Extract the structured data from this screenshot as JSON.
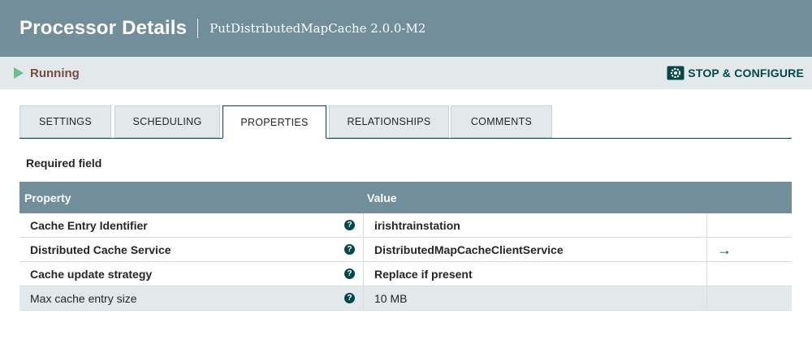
{
  "header": {
    "title": "Processor Details",
    "subtitle": "PutDistributedMapCache 2.0.0-M2"
  },
  "status": {
    "text": "Running",
    "icon": "play-icon"
  },
  "actions": {
    "stop_configure": "STOP & CONFIGURE",
    "icon": "gear-icon"
  },
  "tabs": [
    {
      "label": "SETTINGS"
    },
    {
      "label": "SCHEDULING"
    },
    {
      "label": "PROPERTIES",
      "active": true
    },
    {
      "label": "RELATIONSHIPS"
    },
    {
      "label": "COMMENTS"
    }
  ],
  "properties": {
    "required_label": "Required field",
    "columns": {
      "property": "Property",
      "value": "Value"
    },
    "rows": [
      {
        "name": "Cache Entry Identifier",
        "value": "irishtrainstation",
        "required": true
      },
      {
        "name": "Distributed Cache Service",
        "value": "DistributedMapCacheClientService",
        "required": true,
        "goto": "→"
      },
      {
        "name": "Cache update strategy",
        "value": "Replace if present",
        "required": true
      },
      {
        "name": "Max cache entry size",
        "value": "10 MB",
        "required": false
      }
    ],
    "help_icon": "?"
  },
  "colors": {
    "header": "#728e9b",
    "accent": "#004849",
    "running": "#6dbd8e",
    "status_text": "#7a4b45"
  }
}
